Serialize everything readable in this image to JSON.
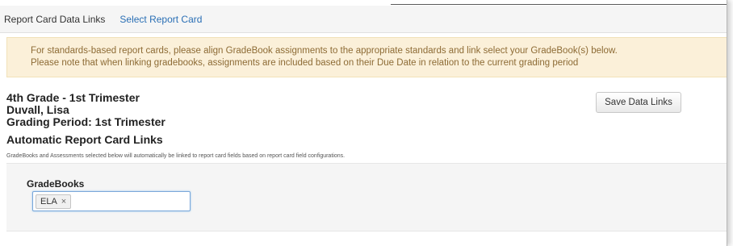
{
  "navbar": {
    "title": "Report Card Data Links",
    "select_link": "Select Report Card"
  },
  "alert": {
    "line1": "For standards-based report cards, please align GradeBook assignments to the appropriate standards and link select your GradeBook(s) below.",
    "line2": "Please note that when linking gradebooks, assignments are included based on their Due Date in relation to the current grading period"
  },
  "report": {
    "class_name": "4th Grade - 1st Trimester",
    "teacher": "Duvall, Lisa",
    "grading_period": "Grading Period: 1st Trimester"
  },
  "actions": {
    "save_label": "Save Data Links"
  },
  "automatic_links": {
    "title": "Automatic Report Card Links",
    "description": "GradeBooks and Assessments selected below will automatically be linked to report card fields based on report card field configurations."
  },
  "gradebooks": {
    "label": "GradeBooks",
    "selected": [
      {
        "label": "ELA",
        "remove_glyph": "×"
      }
    ]
  },
  "colors": {
    "link": "#2a6fb5",
    "alert_bg": "#fbf0d9",
    "alert_text": "#8d6b35",
    "panel_bg": "#f5f5f5"
  }
}
